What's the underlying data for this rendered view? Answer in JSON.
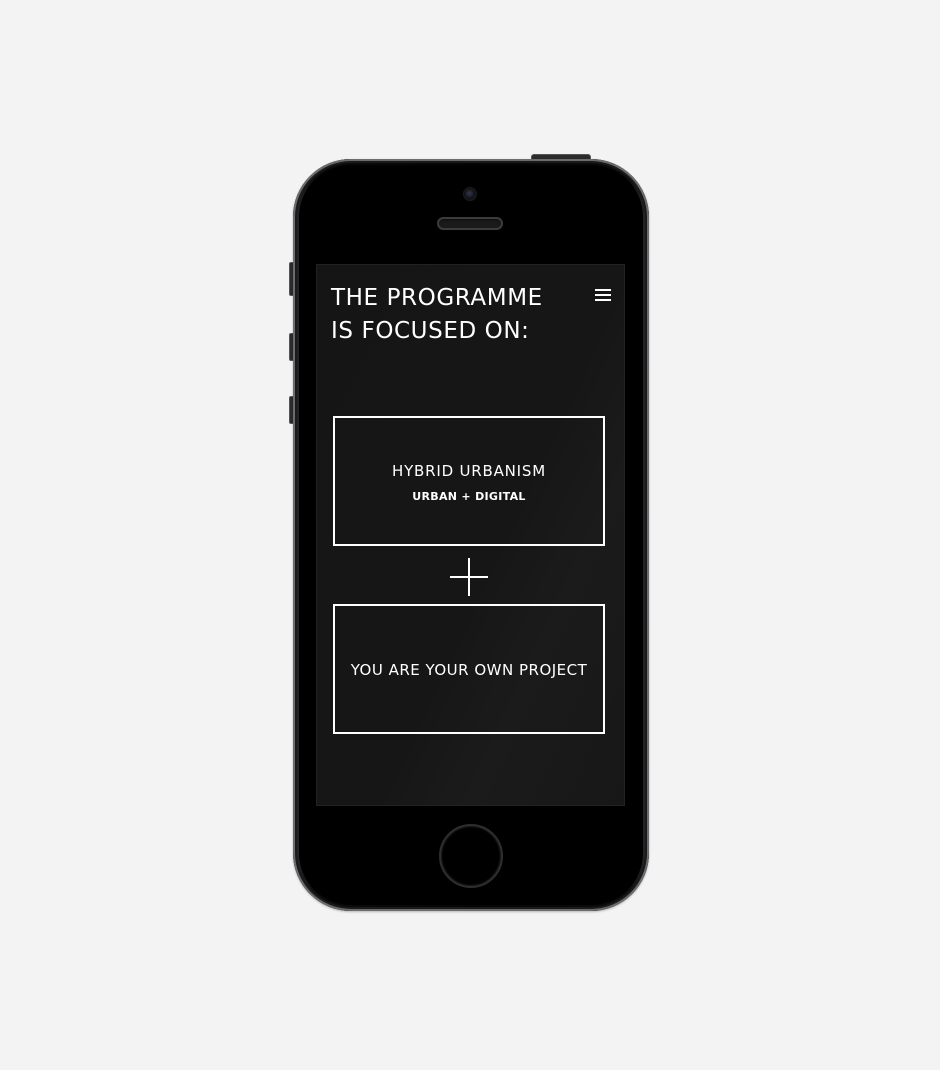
{
  "page": {
    "heading_lines": [
      "THE PROGRAMME",
      "IS FOCUSED ON:"
    ],
    "menu_icon": "hamburger-menu-icon",
    "connector_icon": "plus-icon"
  },
  "cards": [
    {
      "title": "HYBRID URBANISM",
      "subtitle": "URBAN + DIGITAL"
    },
    {
      "title": "YOU ARE YOUR OWN PROJECT"
    }
  ],
  "colors": {
    "page_background": "#f3f3f3",
    "screen_background": "#161616",
    "foreground": "#ffffff",
    "device_body": "#050505"
  }
}
